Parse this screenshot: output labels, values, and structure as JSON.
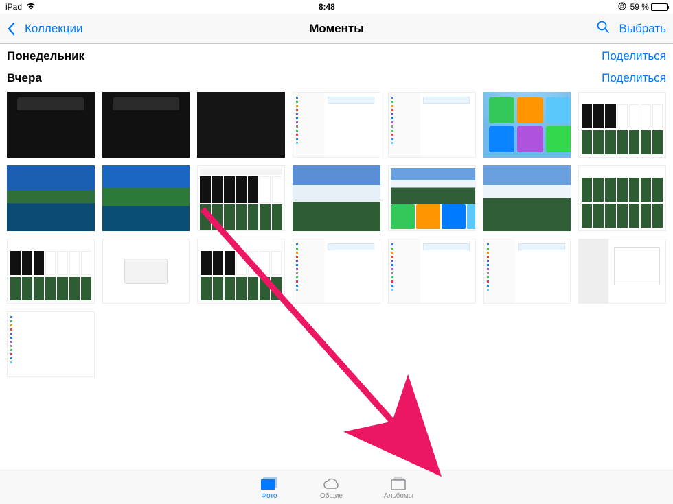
{
  "status": {
    "device": "iPad",
    "time": "8:48",
    "battery_pct": "59 %",
    "battery_fill": 59
  },
  "nav": {
    "back": "Коллекции",
    "title": "Моменты",
    "select": "Выбрать"
  },
  "sections": [
    {
      "title": "Понедельник",
      "share": "Поделиться"
    },
    {
      "title": "Вчера",
      "share": "Поделиться"
    }
  ],
  "tabs": {
    "photos": "Фото",
    "shared": "Общие",
    "albums": "Альбомы"
  },
  "accent": "#007aff"
}
